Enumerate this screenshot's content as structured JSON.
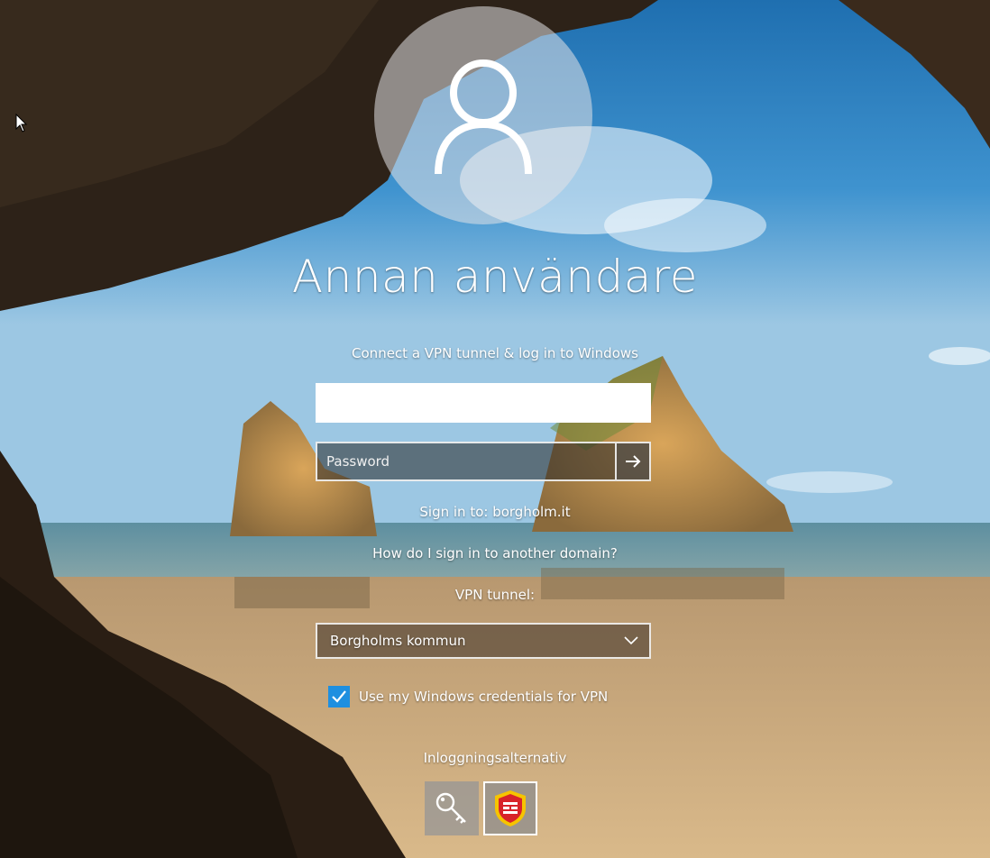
{
  "login": {
    "username_title": "Annan användare",
    "vpn_intro": "Connect a VPN tunnel & log in to Windows",
    "username_placeholder": "",
    "password_placeholder": "Password",
    "submit_icon": "arrow-right-icon",
    "sign_in_domain": "Sign in to: borgholm.it",
    "other_domain_link": "How do I sign in to another domain?",
    "vpn_tunnel_label": "VPN tunnel:",
    "vpn_tunnel_selected": "Borgholms kommun",
    "use_windows_credentials_label": "Use my Windows credentials for VPN",
    "use_windows_credentials_checked": true,
    "signin_options_label": "Inloggningsalternativ",
    "signin_options": [
      {
        "icon": "key-icon"
      },
      {
        "icon": "vpn-shield-icon"
      }
    ]
  },
  "colors": {
    "checkbox_accent": "#1e8fe0",
    "text": "#ffffff",
    "vpn_shield_red": "#d8232a",
    "vpn_shield_yellow": "#f6c400"
  }
}
